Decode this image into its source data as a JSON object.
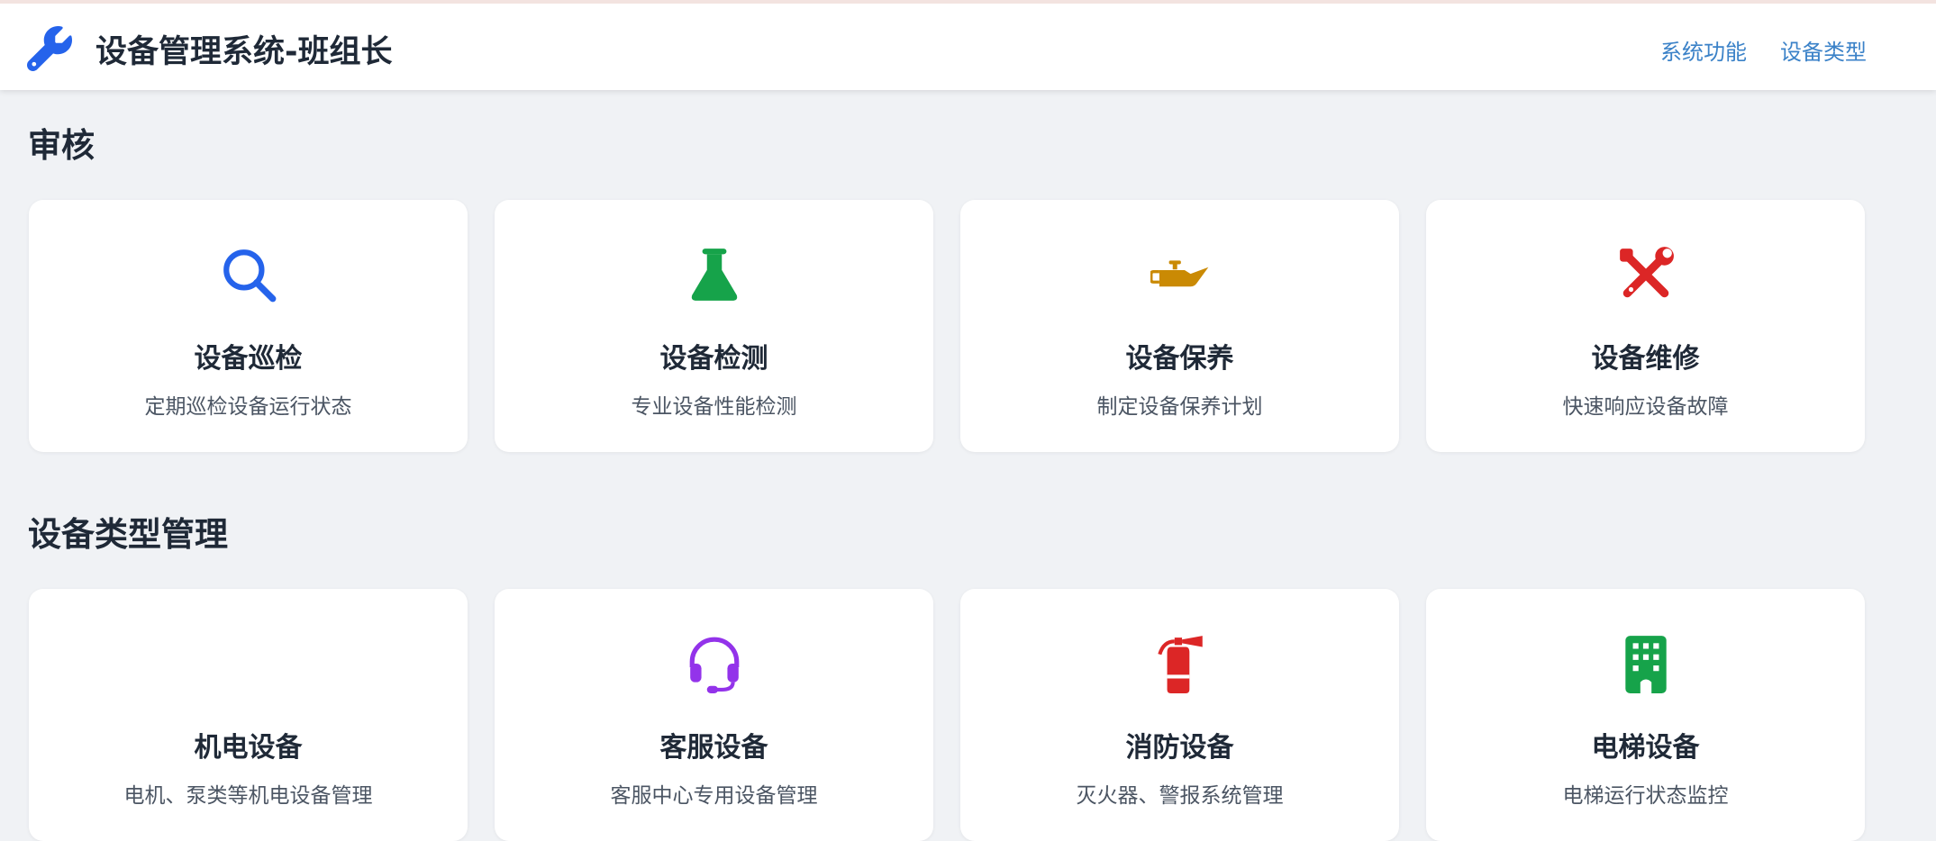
{
  "header": {
    "title": "设备管理系统-班组长",
    "logo_icon": "wrench-icon",
    "nav": [
      {
        "label": "系统功能"
      },
      {
        "label": "设备类型"
      }
    ]
  },
  "sections": [
    {
      "title": "审核",
      "cards": [
        {
          "title": "设备巡检",
          "desc": "定期巡检设备运行状态",
          "icon": "magnifier-icon",
          "color": "#2563eb"
        },
        {
          "title": "设备检测",
          "desc": "专业设备性能检测",
          "icon": "flask-icon",
          "color": "#16a34a"
        },
        {
          "title": "设备保养",
          "desc": "制定设备保养计划",
          "icon": "oil-can-icon",
          "color": "#ca8a04"
        },
        {
          "title": "设备维修",
          "desc": "快速响应设备故障",
          "icon": "tools-icon",
          "color": "#dc2626"
        }
      ]
    },
    {
      "title": "设备类型管理",
      "cards": [
        {
          "title": "机电设备",
          "desc": "电机、泵类等机电设备管理",
          "icon": "",
          "color": ""
        },
        {
          "title": "客服设备",
          "desc": "客服中心专用设备管理",
          "icon": "headset-icon",
          "color": "#9333ea"
        },
        {
          "title": "消防设备",
          "desc": "灭火器、警报系统管理",
          "icon": "fire-extinguisher-icon",
          "color": "#dc2626"
        },
        {
          "title": "电梯设备",
          "desc": "电梯运行状态监控",
          "icon": "building-icon",
          "color": "#16a34a"
        }
      ]
    }
  ],
  "colors": {
    "accent": "#2563eb",
    "nav_link": "#3b82c8",
    "background": "#f0f2f5"
  }
}
